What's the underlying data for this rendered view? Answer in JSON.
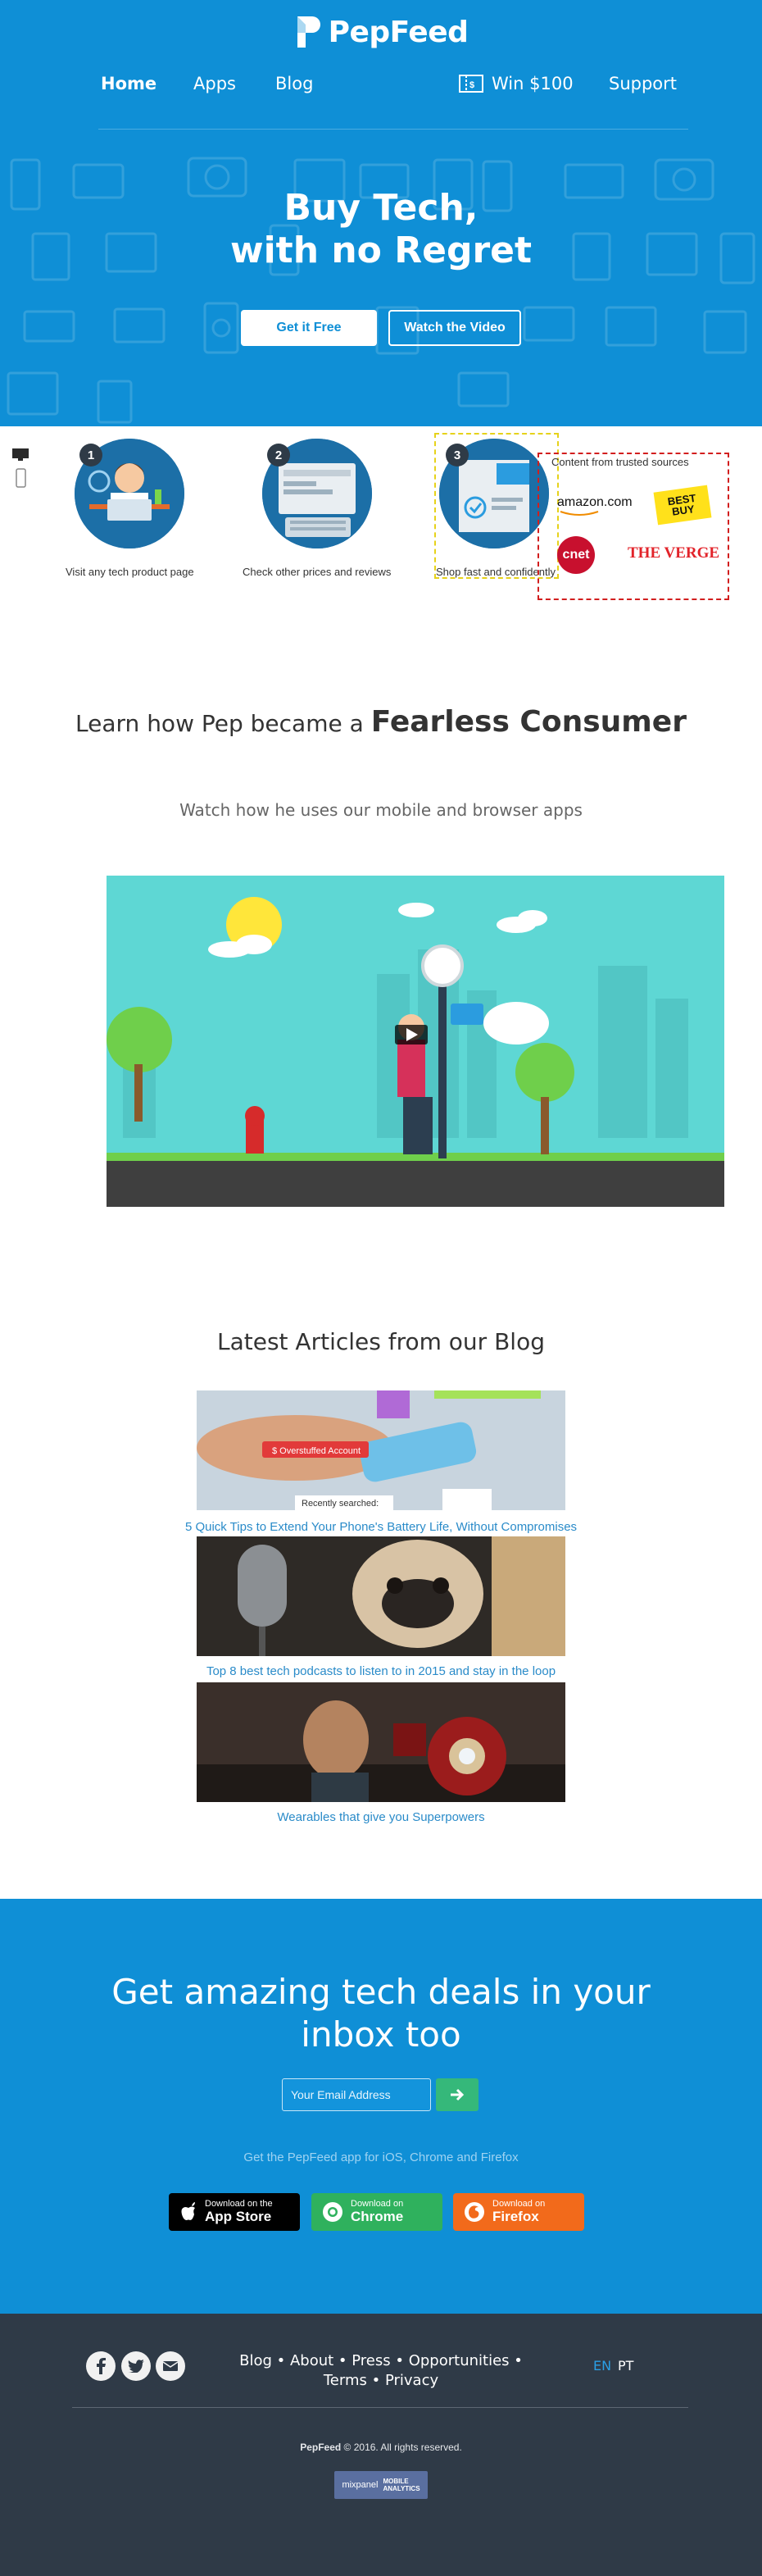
{
  "brand": {
    "name": "PepFeed"
  },
  "nav": {
    "home": "Home",
    "apps": "Apps",
    "blog": "Blog",
    "win": "Win $100",
    "support": "Support"
  },
  "hero": {
    "headline_line1": "Buy Tech,",
    "headline_line2": "with no Regret",
    "cta_free": "Get it Free",
    "cta_video": "Watch the Video"
  },
  "steps": [
    {
      "number": "1",
      "caption": "Visit any tech product page"
    },
    {
      "number": "2",
      "caption": "Check other prices and reviews"
    },
    {
      "number": "3",
      "caption": "Shop fast and confidently"
    }
  ],
  "trusted": {
    "title": "Content from trusted sources",
    "sources": [
      "amazon.com",
      "BEST BUY",
      "cnet",
      "THE VERGE"
    ]
  },
  "learn": {
    "title_prefix": "Learn how Pep became a",
    "title_emphasis": "Fearless Consumer",
    "subtitle": "Watch how he uses our mobile and browser apps"
  },
  "blog": {
    "title": "Latest Articles from our Blog",
    "articles": [
      {
        "title": "5 Quick Tips to Extend Your Phone's Battery Life, Without Compromises"
      },
      {
        "title": "Top 8 best tech podcasts to listen to in 2015 and stay in the loop"
      },
      {
        "title": "Wearables that give you Superpowers"
      }
    ],
    "image1_labels": [
      "$ Overstuffed Account",
      "Recently searched:"
    ]
  },
  "newsletter": {
    "title_line1": "Get amazing tech deals in your",
    "title_line2": "inbox too",
    "email_placeholder": "Your Email Address",
    "apps_line": "Get the PepFeed app for iOS, Chrome and Firefox",
    "stores": [
      {
        "small": "Download on the",
        "big": "App Store",
        "color": "#000000"
      },
      {
        "small": "Download on",
        "big": "Chrome",
        "color": "#2fb15d"
      },
      {
        "small": "Download on",
        "big": "Firefox",
        "color": "#f26a1b"
      }
    ]
  },
  "footer": {
    "links_line1": "Blog • About • Press • Opportunities •",
    "links_line2": "Terms • Privacy",
    "lang_en": "EN",
    "lang_pt": "PT",
    "copyright_brand": "PepFeed",
    "copyright_rest": "© 2016. All rights reserved.",
    "badge_line1": "MOBILE",
    "badge_line2": "ANALYTICS",
    "badge_brand": "mixpanel"
  },
  "colors": {
    "brand_blue": "#0f8fd6",
    "footer_dark": "#2f3a47",
    "link_blue": "#2a8bc9",
    "green": "#35b87a"
  }
}
